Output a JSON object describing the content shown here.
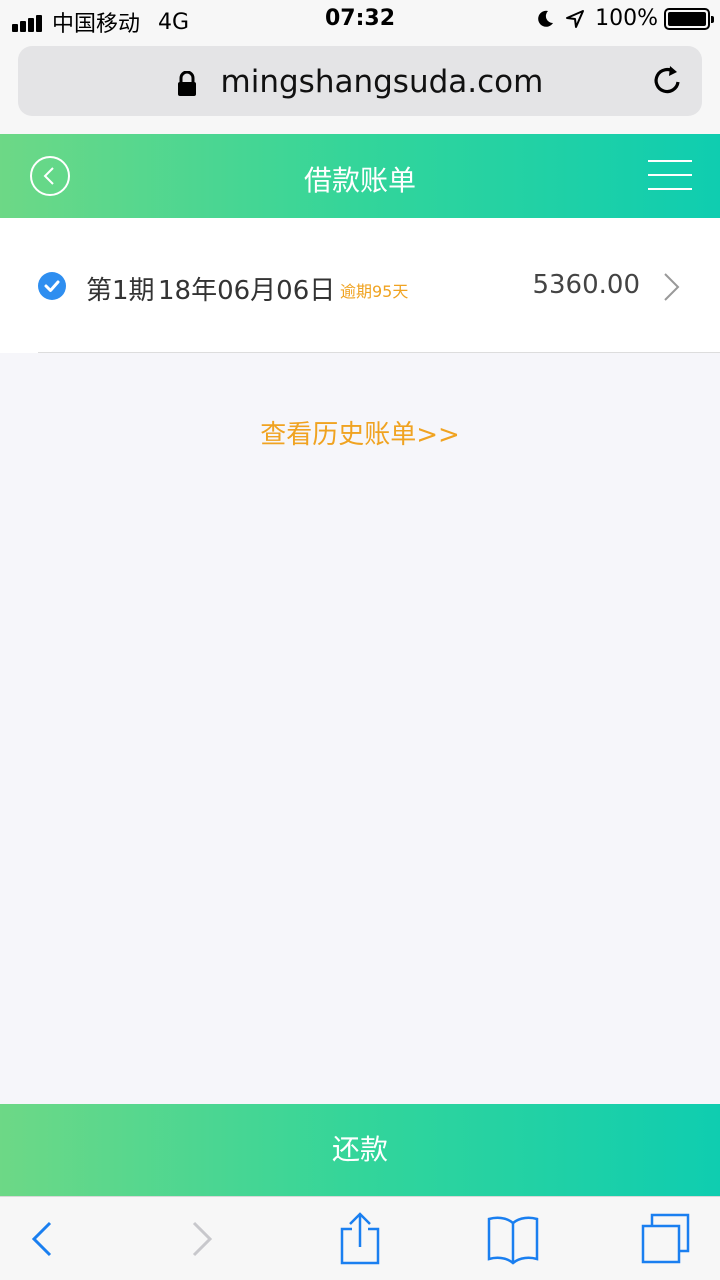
{
  "status_bar": {
    "carrier": "中国移动",
    "network": "4G",
    "time": "07:32",
    "battery": "100%"
  },
  "url_bar": {
    "domain": "mingshangsuda.com"
  },
  "header": {
    "title": "借款账单"
  },
  "bill": {
    "period": "第1期",
    "date": "18年06月06日",
    "overdue": "逾期95天",
    "amount": "5360.00"
  },
  "history_link": "查看历史账单>>",
  "repay_button": "还款",
  "colors": {
    "accent_green_start": "#6dd886",
    "accent_green_end": "#0fcdb0",
    "link_orange": "#f0a321",
    "check_blue": "#2e8ef0",
    "ios_blue": "#1a7ff0"
  },
  "icons": [
    "signal-icon",
    "moon-icon",
    "location-icon",
    "battery-icon",
    "lock-icon",
    "reload-icon",
    "back-circle-icon",
    "menu-icon",
    "check-icon",
    "chevron-right-icon",
    "back-arrow-icon",
    "forward-arrow-icon",
    "share-icon",
    "bookmarks-icon",
    "tabs-icon"
  ]
}
